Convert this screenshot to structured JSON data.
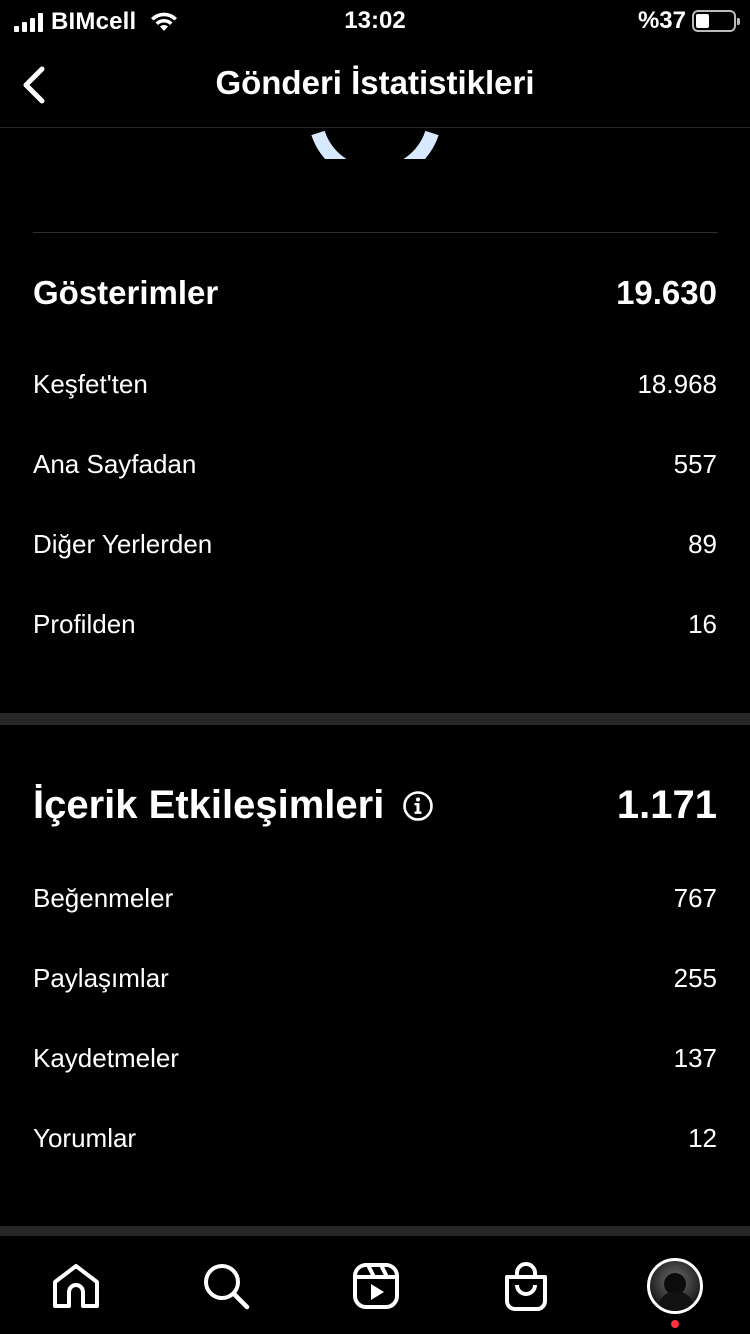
{
  "status_bar": {
    "carrier": "BIMcell",
    "time": "13:02",
    "battery": "%37",
    "battery_level": 0.37
  },
  "header": {
    "title": "Gönderi İstatistikleri"
  },
  "impressions": {
    "label": "Gösterimler",
    "value": "19.630",
    "items": [
      {
        "label": "Keşfet'ten",
        "value": "18.968"
      },
      {
        "label": "Ana Sayfadan",
        "value": "557"
      },
      {
        "label": "Diğer Yerlerden",
        "value": "89"
      },
      {
        "label": "Profilden",
        "value": "16"
      }
    ]
  },
  "content_interactions": {
    "label": "İçerik Etkileşimleri",
    "value": "1.171",
    "items": [
      {
        "label": "Beğenmeler",
        "value": "767"
      },
      {
        "label": "Paylaşımlar",
        "value": "255"
      },
      {
        "label": "Kaydetmeler",
        "value": "137"
      },
      {
        "label": "Yorumlar",
        "value": "12"
      }
    ]
  },
  "tabbar": {
    "tabs": [
      "home-icon",
      "search-icon",
      "reels-icon",
      "shop-icon",
      "profile-avatar"
    ]
  },
  "colors": {
    "background": "#000000",
    "text": "#ffffff",
    "separator": "#262626",
    "ring_accent": "#d6e9ff",
    "notification_dot": "#ff3040"
  }
}
